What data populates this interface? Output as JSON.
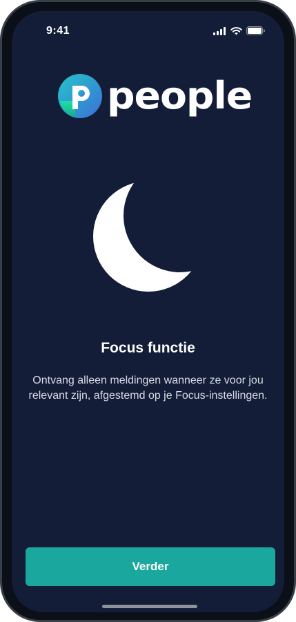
{
  "status_bar": {
    "time": "9:41",
    "icons": [
      "signal-icon",
      "wifi-icon",
      "battery-icon"
    ]
  },
  "logo": {
    "word": "people",
    "icon": "people-logo-icon",
    "colors": {
      "gradient_start": "#2ab7c6",
      "gradient_end": "#3a7bd5",
      "accent": "#1fd39a"
    }
  },
  "illustration": {
    "icon": "moon-icon",
    "color": "#ffffff"
  },
  "content": {
    "title": "Focus functie",
    "description": "Ontvang alleen meldingen wanneer ze voor jou relevant zijn, afgestemd op je Focus-instellingen."
  },
  "actions": {
    "continue_label": "Verder"
  },
  "colors": {
    "background": "#131d38",
    "button": "#1aa79e",
    "text": "#ffffff"
  }
}
